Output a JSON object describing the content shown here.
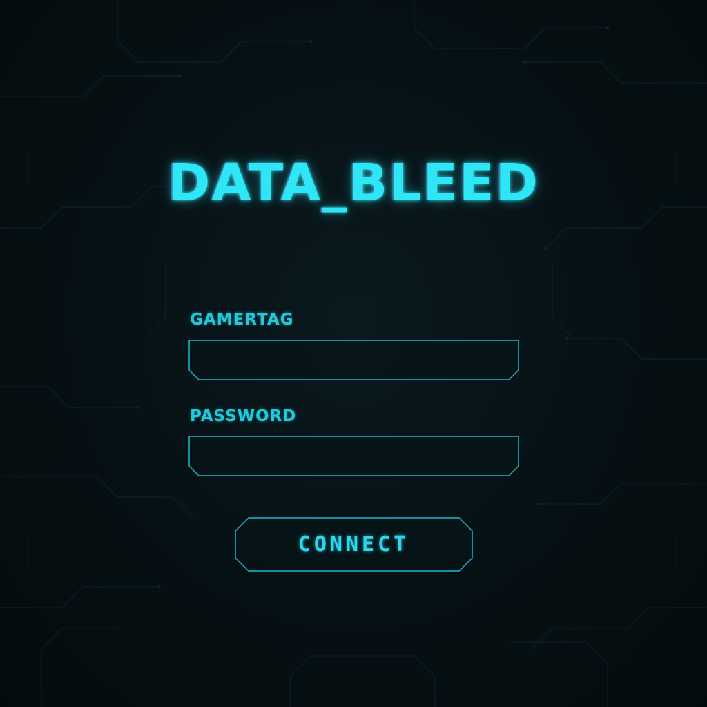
{
  "app": {
    "title": "DATA_BLEED"
  },
  "login_form": {
    "gamertag": {
      "label": "GAMERTAG",
      "value": "",
      "placeholder": ""
    },
    "password": {
      "label": "PASSWORD",
      "value": "",
      "placeholder": ""
    },
    "connect_button": {
      "label": "CONNECT"
    }
  },
  "theme": {
    "background": "#061013",
    "accent": "#2ee6f5",
    "label_color": "#22c9dc",
    "border_color": "#1fb8c9",
    "circuit_color": "#0c2a2f"
  }
}
